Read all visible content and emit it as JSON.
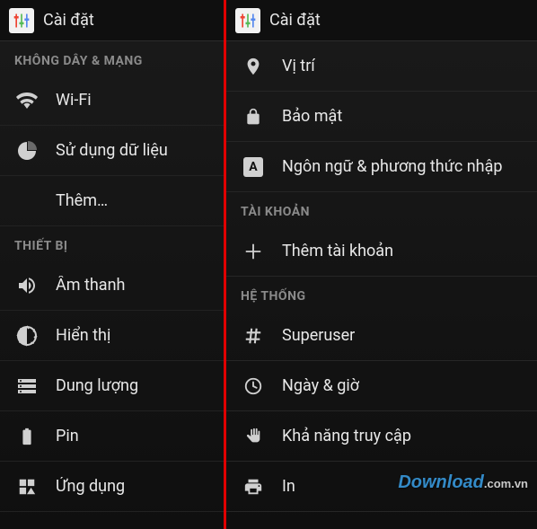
{
  "app": {
    "title": "Cài đặt"
  },
  "left": {
    "sections": [
      {
        "header": "KHÔNG DÂY & MẠNG",
        "items": [
          {
            "icon": "wifi-icon",
            "label": "Wi-Fi"
          },
          {
            "icon": "data-usage-icon",
            "label": "Sử dụng dữ liệu"
          },
          {
            "icon": "",
            "label": "Thêm…"
          }
        ]
      },
      {
        "header": "THIẾT BỊ",
        "items": [
          {
            "icon": "sound-icon",
            "label": "Âm thanh"
          },
          {
            "icon": "display-icon",
            "label": "Hiển thị"
          },
          {
            "icon": "storage-icon",
            "label": "Dung lượng"
          },
          {
            "icon": "battery-icon",
            "label": "Pin"
          },
          {
            "icon": "apps-icon",
            "label": "Ứng dụng"
          }
        ]
      }
    ]
  },
  "right": {
    "sections": [
      {
        "header": "",
        "items": [
          {
            "icon": "location-icon",
            "label": "Vị trí"
          },
          {
            "icon": "lock-icon",
            "label": "Bảo mật"
          },
          {
            "icon": "input-icon",
            "label": "Ngôn ngữ & phương thức nhập"
          }
        ]
      },
      {
        "header": "TÀI KHOẢN",
        "items": [
          {
            "icon": "plus-icon",
            "label": "Thêm tài khoản"
          }
        ]
      },
      {
        "header": "HỆ THỐNG",
        "items": [
          {
            "icon": "hash-icon",
            "label": "Superuser"
          },
          {
            "icon": "clock-icon",
            "label": "Ngày & giờ"
          },
          {
            "icon": "hand-icon",
            "label": "Khả năng truy cập"
          },
          {
            "icon": "printer-icon",
            "label": "In"
          }
        ]
      }
    ]
  },
  "watermark": {
    "main": "Download",
    "suffix": ".com.vn"
  }
}
